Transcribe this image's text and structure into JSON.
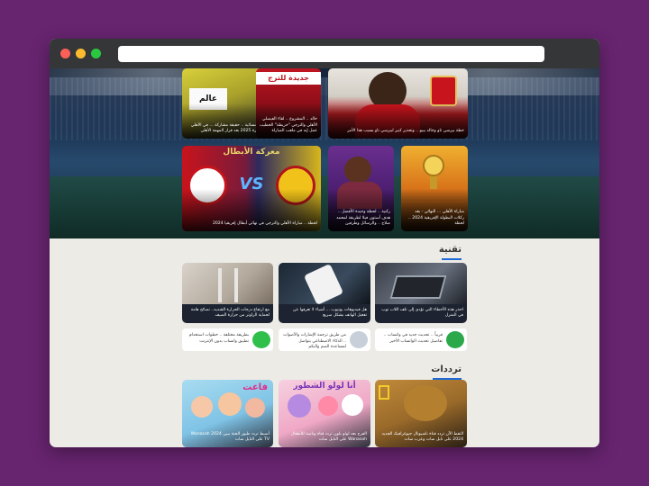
{
  "hero": {
    "cards": [
      {
        "caption": "كرة النسائية .. حقيقة مشاركة ... في الأهلي بالقاهرة 2025 بعد قرار المهمة الأهلي"
      },
      {
        "caption": "خالد .. المشروع .. لقاء الفيصلي الأهلي والترجي \"خريطة\" الخطيب عمل إيه في ملعب المباراة"
      },
      {
        "caption": "خطة بيرسي تاو وخالد بيبو .. وتحذير كبير لبيرسي تاو بسبب هذا الأمر"
      },
      {
        "caption": "لحظة .. مباراة الأهلي والترجي في نهائي أبطال إفريقيا 2024"
      },
      {
        "caption": "ركنية .. لحظة وحيدة الأفضل .. هدف أستون فيلا لطريقة لمحمد صلاح .. والرسائل وطرفين"
      },
      {
        "caption": "مباراة الأهلي ... النهائي - بعد ركلات البطولة الإفريقية 2024 .. لحظة"
      }
    ],
    "banner_1": "عالم",
    "banner_2": "جديدة للترج",
    "banner_3": "معركة الأبطال",
    "vs_text": "VS"
  },
  "tech": {
    "title": "تقنية",
    "cards": [
      {
        "caption": "احذر هذه الأخطاء التي تؤدي إلى تلف اللاب توب في المنزل"
      },
      {
        "caption": "هل فيديوهات يوتيوب ... أشياء لا تعرفها عن تفعيل الهاتف بشكل سريع"
      },
      {
        "caption": "مع ارتفاع درجات الحرارة الشديد.. نصائح هامة لحماية الراوتر من حرارة الصيف"
      }
    ],
    "mini": [
      {
        "caption": "قريباً .. تحديث جديد في واتساب .. تفاصيل تحديث الواتساب الأخير"
      },
      {
        "caption": "من طريق ترجمة الإشارات والأصوات .. الذكاء الاصطناعي يتواصل لمساعدة الصم والبكم"
      },
      {
        "caption": "بطريقة مختلفة .. خطوات استخدام تطبيق واتساب بدون الإنترنت"
      }
    ]
  },
  "freq": {
    "title": "ترددات",
    "cards": [
      {
        "caption": "التقط الآن تردد قناة ناشيونال جيوغرافيك الجديد 2024 على نايل سات وعرب سات"
      },
      {
        "caption": "الفرح بعد لولو بلون تردد قناة وناسة للأطفال Wanasah على النايل سات"
      },
      {
        "caption": "أضبط تردد طيور الجنة بيبي 2024 Wanasah TV على النايل سات"
      }
    ],
    "banner_1": "أنا لولو الشطور",
    "banner_2": "فاعت"
  },
  "colors": {
    "page_bg": "#67246f",
    "window_bg": "#ecebe6",
    "accent": "#1d6ad8"
  }
}
